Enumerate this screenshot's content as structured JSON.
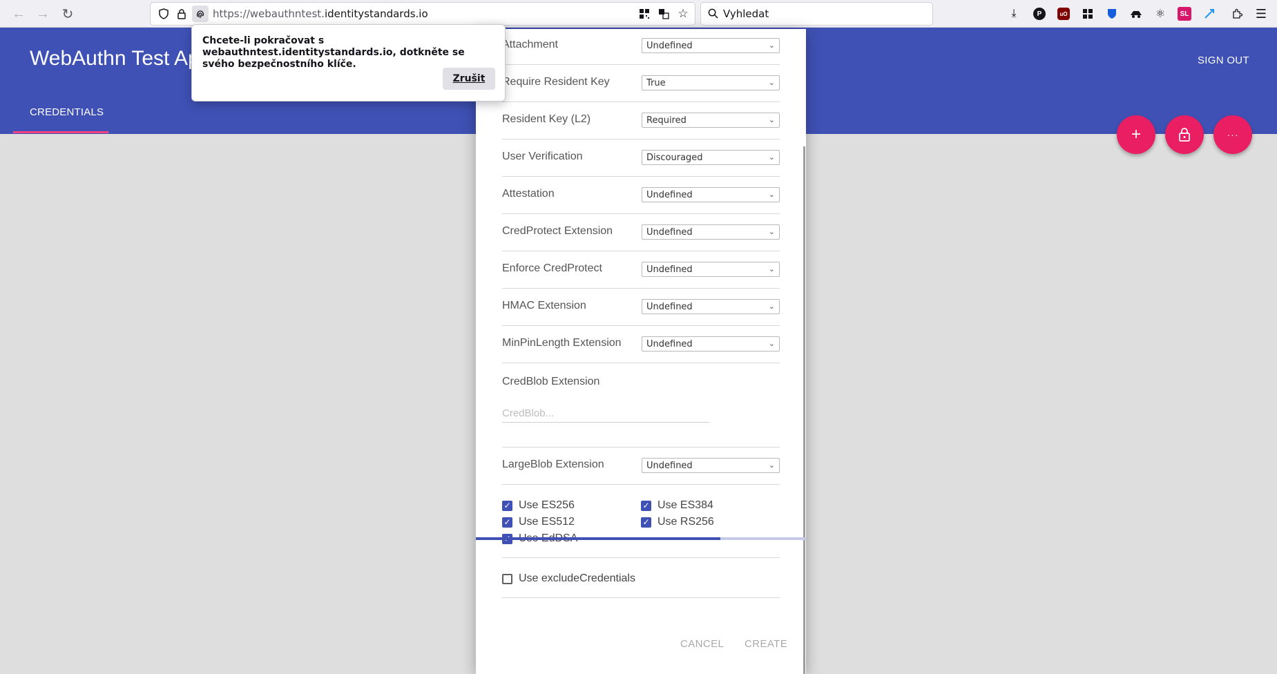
{
  "browser": {
    "url_host_prefix": "https://webauthntest.",
    "url_host_domain": "identitystandards.io",
    "search_placeholder": "Vyhledat",
    "ext_sl_label": "SL",
    "ext_p_label": "P",
    "ext_ub_label": "uO"
  },
  "app": {
    "title": "WebAuthn Test App",
    "sign_out": "SIGN OUT",
    "tab_credentials": "CREDENTIALS",
    "fab_add": "+",
    "fab_more": "···",
    "accent_color": "#3f51b5",
    "fab_color": "#e91e63"
  },
  "prompt": {
    "message": "Chcete-li pokračovat s webauthntest.identitystandards.io, dotkněte se svého bezpečnostního klíče.",
    "cancel": "Zrušit"
  },
  "dialog": {
    "rows": [
      {
        "label": "Attachment",
        "value": "Undefined"
      },
      {
        "label": "Require Resident Key",
        "value": "True"
      },
      {
        "label": "Resident Key (L2)",
        "value": "Required"
      },
      {
        "label": "User Verification",
        "value": "Discouraged"
      },
      {
        "label": "Attestation",
        "value": "Undefined"
      },
      {
        "label": "CredProtect Extension",
        "value": "Undefined"
      },
      {
        "label": "Enforce CredProtect",
        "value": "Undefined"
      },
      {
        "label": "HMAC Extension",
        "value": "Undefined"
      },
      {
        "label": "MinPinLength Extension",
        "value": "Undefined"
      }
    ],
    "credblob_label": "CredBlob Extension",
    "credblob_placeholder": "CredBlob...",
    "largeblob": {
      "label": "LargeBlob Extension",
      "value": "Undefined"
    },
    "algorithms": [
      {
        "label": "Use ES256",
        "checked": true
      },
      {
        "label": "Use ES384",
        "checked": true
      },
      {
        "label": "Use ES512",
        "checked": true
      },
      {
        "label": "Use RS256",
        "checked": true
      },
      {
        "label": "Use EdDSA",
        "checked": true
      }
    ],
    "exclude_credentials": {
      "label": "Use excludeCredentials",
      "checked": false
    },
    "cancel": "CANCEL",
    "create": "CREATE",
    "progress": 0.74
  }
}
